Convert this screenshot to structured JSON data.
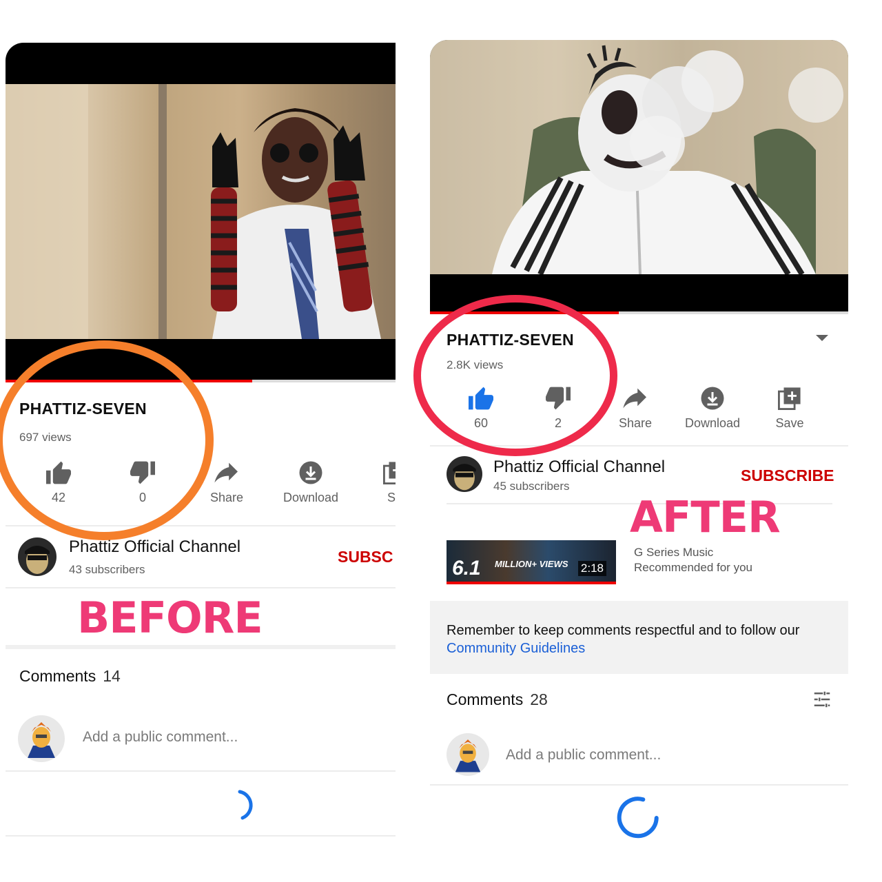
{
  "colors": {
    "subscribe_red": "#cc0000",
    "progress_red": "#e00000",
    "like_active_blue": "#1a73e8",
    "link_blue": "#1a5fd6",
    "annotation_pink": "#ee3a76",
    "circle_orange": "#f57f2b",
    "circle_red": "#ee2a4a"
  },
  "before": {
    "label": "BEFORE",
    "video_title": "PHATTIZ-SEVEN",
    "views": "697 views",
    "actions": [
      {
        "icon": "thumbs-up-icon",
        "label": "42"
      },
      {
        "icon": "thumbs-down-icon",
        "label": "0"
      },
      {
        "icon": "share-icon",
        "label": "Share"
      },
      {
        "icon": "download-icon",
        "label": "Download"
      },
      {
        "icon": "save-icon",
        "label": "Sa"
      }
    ],
    "channel_name": "Phattiz Official Channel",
    "subscribers": "43 subscribers",
    "subscribe_label": "SUBSC",
    "comments_label": "Comments",
    "comments_count": "14",
    "comment_placeholder": "Add a public comment..."
  },
  "after": {
    "label": "AFTER",
    "video_title": "PHATTIZ-SEVEN",
    "views": "2.8K views",
    "actions": [
      {
        "icon": "thumbs-up-icon",
        "label": "60",
        "active": true
      },
      {
        "icon": "thumbs-down-icon",
        "label": "2"
      },
      {
        "icon": "share-icon",
        "label": "Share"
      },
      {
        "icon": "download-icon",
        "label": "Download"
      },
      {
        "icon": "save-icon",
        "label": "Save"
      }
    ],
    "channel_name": "Phattiz Official Channel",
    "subscribers": "45 subscribers",
    "subscribe_label": "SUBSCRIBE",
    "recommended": {
      "thumb_big": "6.1",
      "thumb_small": "MILLION+ VIEWS",
      "duration": "2:18",
      "title": "G Series Music",
      "subtitle": "Recommended for you"
    },
    "notice_text": "Remember to keep comments respectful and to follow our ",
    "notice_link": "Community Guidelines",
    "comments_label": "Comments",
    "comments_count": "28",
    "comment_placeholder": "Add a public comment..."
  }
}
